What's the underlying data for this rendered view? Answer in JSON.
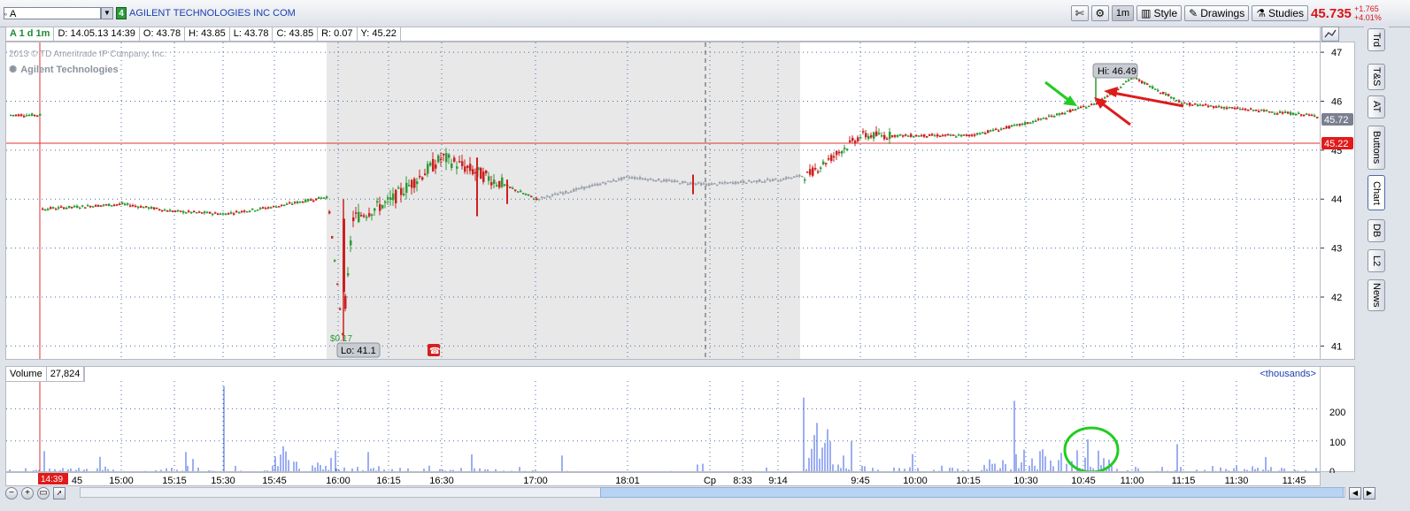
{
  "toolbar": {
    "symbol": "A",
    "link_number": "4",
    "company": "AGILENT TECHNOLOGIES INC COM",
    "timeframe": "1m",
    "style": "Style",
    "drawings": "Drawings",
    "studies": "Studies",
    "last": "45.735",
    "change": "+1.765",
    "change_pct": "+4.01%"
  },
  "infobar": {
    "sym": "A 1 d 1m",
    "date": "D: 14.05.13 14:39",
    "open": "O: 43.78",
    "high": "H: 43.85",
    "low": "L: 43.78",
    "close": "C: 43.85",
    "range": "R: 0.07",
    "y": "Y: 45.22"
  },
  "watermark": "2013 © TD Ameritrade IP Company, Inc.",
  "company_label": "Agilent Technologies",
  "side_tabs": [
    "Trd",
    "T&S",
    "AT",
    "Buttons",
    "Chart",
    "DB",
    "L2",
    "News"
  ],
  "price_axis": {
    "ticks": [
      "47",
      "46",
      "45",
      "44",
      "43",
      "42",
      "41"
    ],
    "last_box": "45.72",
    "line_box": "45.22"
  },
  "annotations": {
    "hi": "Hi: 46.49",
    "lo": "Lo: 41.1",
    "dividend": "$0.17"
  },
  "volume": {
    "label": "Volume",
    "value": "27,824",
    "unit": "<thousands>",
    "ticks": [
      "200",
      "100",
      "0"
    ]
  },
  "x_axis": {
    "cursor_time": "14:39",
    "labels": [
      "45",
      "15:00",
      "15:15",
      "15:30",
      "15:45",
      "16:00",
      "16:15",
      "16:30",
      "17:00",
      "18:01",
      "Cp",
      "8:33",
      "9:14",
      "9:45",
      "10:00",
      "10:15",
      "10:30",
      "10:45",
      "11:00",
      "11:15",
      "11:30",
      "11:45"
    ]
  },
  "colors": {
    "up": "#2f9a35",
    "down": "#cc1f1f",
    "extended": "#9aa0a8",
    "last_red": "#d7141a",
    "highlight_green": "#22cc22"
  },
  "chart_data": {
    "type": "candlestick",
    "xlabel": "",
    "ylabel": "",
    "ylim": [
      40.7,
      47.2
    ],
    "price_path": [
      {
        "t": "14:39",
        "p": 43.8
      },
      {
        "t": "15:00",
        "p": 43.9
      },
      {
        "t": "15:15",
        "p": 43.75
      },
      {
        "t": "15:30",
        "p": 43.7
      },
      {
        "t": "15:45",
        "p": 43.85
      },
      {
        "t": "16:00",
        "p": 44.05
      },
      {
        "t": "16:01",
        "p": 41.1
      },
      {
        "t": "16:05",
        "p": 43.6
      },
      {
        "t": "16:15",
        "p": 43.95
      },
      {
        "t": "16:30",
        "p": 44.85
      },
      {
        "t": "16:40",
        "p": 44.0
      },
      {
        "t": "17:00",
        "p": 44.45
      },
      {
        "t": "18:01",
        "p": 44.3
      },
      {
        "t": "Cp",
        "p": 44.4
      },
      {
        "t": "9:14",
        "p": 44.5
      },
      {
        "t": "9:30",
        "p": 45.3
      },
      {
        "t": "9:45",
        "p": 45.3
      },
      {
        "t": "10:00",
        "p": 45.3
      },
      {
        "t": "10:15",
        "p": 45.55
      },
      {
        "t": "10:30",
        "p": 45.95
      },
      {
        "t": "10:45",
        "p": 46.49
      },
      {
        "t": "11:00",
        "p": 45.95
      },
      {
        "t": "11:15",
        "p": 45.85
      },
      {
        "t": "11:30",
        "p": 45.7
      },
      {
        "t": "11:45",
        "p": 45.72
      }
    ],
    "volume_ylim": [
      0,
      270
    ]
  }
}
